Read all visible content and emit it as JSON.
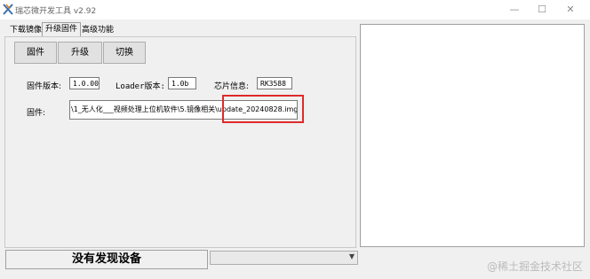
{
  "window": {
    "title": "瑞芯微开发工具 v2.92",
    "minimize_glyph": "—",
    "maximize_glyph": "☐",
    "close_glyph": "✕"
  },
  "tabs": [
    {
      "label": "下载镜像"
    },
    {
      "label": "升级固件",
      "active": true
    },
    {
      "label": "高级功能"
    }
  ],
  "toolbar": {
    "firmware_label": "固件",
    "upgrade_label": "升级",
    "switch_label": "切换"
  },
  "info": {
    "fw_version_label": "固件版本:",
    "fw_version_value": "1.0.00",
    "loader_version_label": "Loader版本:",
    "loader_version_value": "1.0b",
    "chip_info_label": "芯片信息:",
    "chip_info_value": "RK3588",
    "firmware_path_label": "固件:",
    "firmware_path_value": "\\1_无人化___视频处理上位机软件\\5.镜像相关\\update_20240828.img"
  },
  "status": {
    "message": "没有发现设备"
  },
  "device_select": {
    "value": ""
  },
  "watermark": "@稀土掘金技术社区",
  "colors": {
    "highlight": "#e02a2a"
  },
  "icons": {
    "app": "app-icon",
    "dropdown": "chevron-down-icon"
  }
}
